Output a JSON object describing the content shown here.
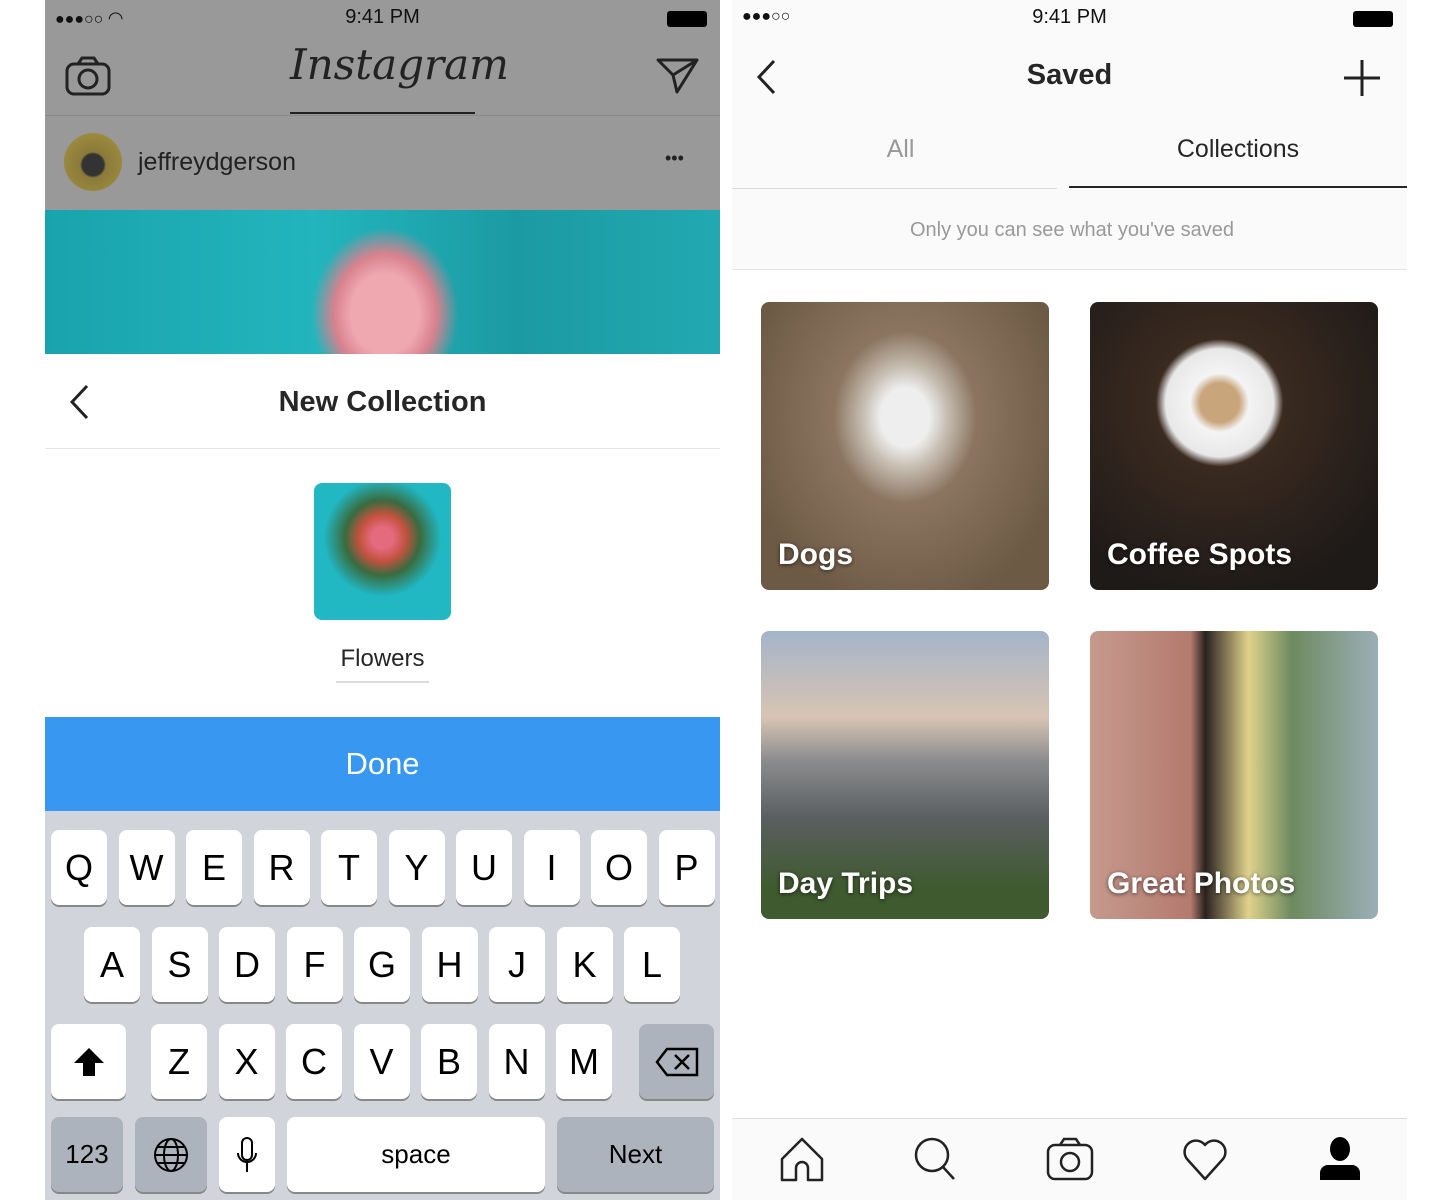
{
  "left": {
    "status": {
      "time": "9:41 PM"
    },
    "header": {
      "logo": "Instagram"
    },
    "post": {
      "username": "jeffreydgerson",
      "more": "•••"
    },
    "sheet": {
      "title": "New Collection",
      "collection_name": "Flowers",
      "done_label": "Done"
    },
    "keyboard": {
      "row1": [
        "Q",
        "W",
        "E",
        "R",
        "T",
        "Y",
        "U",
        "I",
        "O",
        "P"
      ],
      "row2": [
        "A",
        "S",
        "D",
        "F",
        "G",
        "H",
        "J",
        "K",
        "L"
      ],
      "row3": [
        "Z",
        "X",
        "C",
        "V",
        "B",
        "N",
        "M"
      ],
      "numbers": "123",
      "space": "space",
      "next": "Next"
    }
  },
  "right": {
    "status": {
      "time": "9:41 PM"
    },
    "header": {
      "title": "Saved"
    },
    "tabs": [
      {
        "label": "All",
        "active": false
      },
      {
        "label": "Collections",
        "active": true
      }
    ],
    "notice": "Only you can see what you've saved",
    "collections": [
      {
        "label": "Dogs"
      },
      {
        "label": "Coffee Spots"
      },
      {
        "label": "Day Trips"
      },
      {
        "label": "Great Photos"
      }
    ],
    "nav": [
      "home-icon",
      "search-icon",
      "camera-icon",
      "heart-icon",
      "profile-icon"
    ]
  },
  "colors": {
    "accent": "#3897f0",
    "overlay": "#999999",
    "keyboard_bg": "#d1d5db"
  }
}
